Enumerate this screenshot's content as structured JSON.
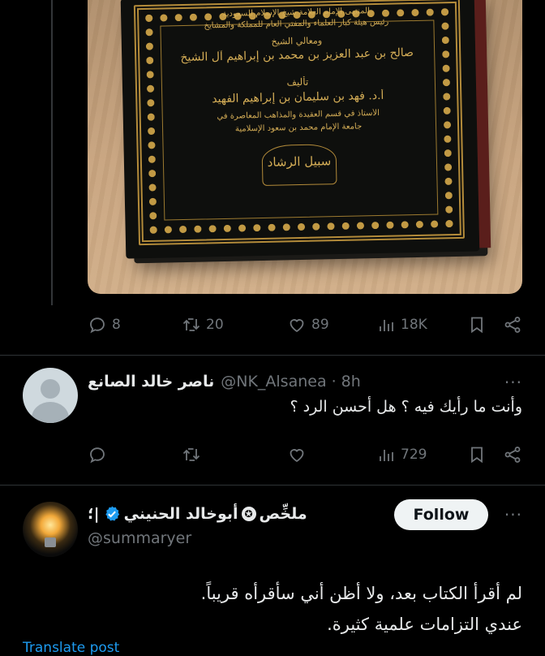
{
  "tweet": {
    "media": {
      "book_cover_lines": [
        "المنتهى الإمام العلامة شيخ الإسلام للسعودية",
        "رئيس هيئة كبار العلماء والمفتي العام للمملكة والمشايخ",
        "ومعالي الشيخ",
        "صالح بن عبد العزيز بن محمد بن إبراهيم آل الشيخ",
        "تأليف",
        "أ.د. فهد بن سليمان بن إبراهيم الفهيد",
        "الأستاذ في قسم العقيدة والمذاهب المعاصرة في",
        "جامعة الإمام محمد بن سعود الإسلامية",
        "سبيل الرشاد"
      ]
    },
    "actions": {
      "replies": "8",
      "retweets": "20",
      "likes": "89",
      "views": "18K"
    }
  },
  "reply": {
    "name": "ناصر خالد الصانع",
    "handle": "@NK_Alsanea",
    "separator": "·",
    "time": "8h",
    "text": "وأنت ما رأيك فيه ؟ هل أحسن الرد ؟",
    "actions": {
      "views": "729"
    }
  },
  "main_post": {
    "name_prefix": "؛|",
    "name_main": "أبوخالد الحنيني",
    "name_suffix": "ملخِّص",
    "badge_glyph": "✪",
    "handle": "@summaryer",
    "follow_label": "Follow",
    "text_line1": "لم أقرأ الكتاب بعد، ولا أظن أني سأقرأه قريباً.",
    "text_line2": "عندي التزامات علمية كثيرة.",
    "translate_label": "Translate post"
  },
  "more_glyph": "···",
  "colors": {
    "accent": "#1d9bf0",
    "muted": "#71767b",
    "divider": "#2f3336"
  },
  "icons": [
    "reply-icon",
    "retweet-icon",
    "like-icon",
    "views-icon",
    "bookmark-icon",
    "share-icon",
    "verified-icon",
    "more-icon"
  ]
}
